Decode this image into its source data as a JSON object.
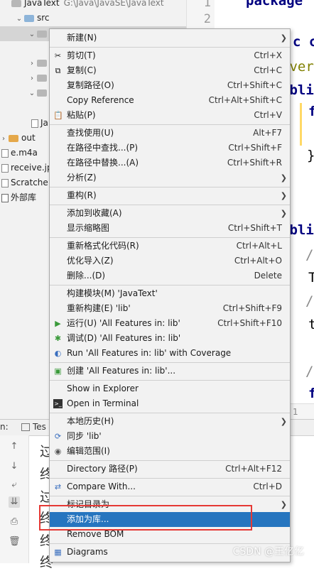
{
  "tree": {
    "project_name": "JavaText",
    "project_path": "G:\\Java\\JavaSE\\JavaText",
    "src_label": "src",
    "hidden_item_label": "Ja",
    "out_label": "out",
    "files": [
      "e.m4a",
      "receive.jp"
    ],
    "scratches_label": "Scratche",
    "external_label": "外部库"
  },
  "gutter": {
    "line_numbers": [
      "1",
      "2"
    ]
  },
  "editor": {
    "lines": [
      "package",
      "c c",
      "Over",
      "ubli",
      "f",
      "}",
      "ubli",
      "/",
      "T",
      "/",
      "t",
      "/",
      "f"
    ],
    "footer_number": "1"
  },
  "bottom": {
    "tab_prefix": "n:",
    "tab_label": "Tes",
    "output_lines": [
      "过",
      "终",
      "过",
      "终",
      "终",
      "终"
    ]
  },
  "menu": {
    "items": [
      {
        "label": "新建(N)",
        "shortcut": "",
        "submenu": true,
        "icon": ""
      },
      {
        "label": "剪切(T)",
        "shortcut": "Ctrl+X",
        "submenu": false,
        "icon": "cut-icon"
      },
      {
        "label": "复制(C)",
        "shortcut": "Ctrl+C",
        "submenu": false,
        "icon": "copy-icon"
      },
      {
        "label": "复制路径(O)",
        "shortcut": "Ctrl+Shift+C",
        "submenu": false,
        "icon": ""
      },
      {
        "label": "Copy Reference",
        "shortcut": "Ctrl+Alt+Shift+C",
        "submenu": false,
        "icon": ""
      },
      {
        "label": "粘贴(P)",
        "shortcut": "Ctrl+V",
        "submenu": false,
        "icon": "paste-icon"
      },
      {
        "label": "查找使用(U)",
        "shortcut": "Alt+F7",
        "submenu": false,
        "icon": ""
      },
      {
        "label": "在路径中查找...(P)",
        "shortcut": "Ctrl+Shift+F",
        "submenu": false,
        "icon": ""
      },
      {
        "label": "在路径中替换...(A)",
        "shortcut": "Ctrl+Shift+R",
        "submenu": false,
        "icon": ""
      },
      {
        "label": "分析(Z)",
        "shortcut": "",
        "submenu": true,
        "icon": ""
      },
      {
        "label": "重构(R)",
        "shortcut": "",
        "submenu": true,
        "icon": ""
      },
      {
        "label": "添加到收藏(A)",
        "shortcut": "",
        "submenu": true,
        "icon": ""
      },
      {
        "label": "显示缩略图",
        "shortcut": "Ctrl+Shift+T",
        "submenu": false,
        "icon": ""
      },
      {
        "label": "重新格式化代码(R)",
        "shortcut": "Ctrl+Alt+L",
        "submenu": false,
        "icon": ""
      },
      {
        "label": "优化导入(Z)",
        "shortcut": "Ctrl+Alt+O",
        "submenu": false,
        "icon": ""
      },
      {
        "label": "删除...(D)",
        "shortcut": "Delete",
        "submenu": false,
        "icon": ""
      },
      {
        "label": "构建模块(M) 'JavaText'",
        "shortcut": "",
        "submenu": false,
        "icon": ""
      },
      {
        "label": "重新构建(E) 'lib'",
        "shortcut": "Ctrl+Shift+F9",
        "submenu": false,
        "icon": ""
      },
      {
        "label": "运行(U) 'All Features in: lib'",
        "shortcut": "Ctrl+Shift+F10",
        "submenu": false,
        "icon": "run-icon"
      },
      {
        "label": "调试(D) 'All Features in: lib'",
        "shortcut": "",
        "submenu": false,
        "icon": "debug-icon"
      },
      {
        "label": "Run 'All Features in: lib' with Coverage",
        "shortcut": "",
        "submenu": false,
        "icon": "coverage-icon"
      },
      {
        "label": "创建 'All Features in: lib'...",
        "shortcut": "",
        "submenu": false,
        "icon": "create-config-icon"
      },
      {
        "label": "Show in Explorer",
        "shortcut": "",
        "submenu": false,
        "icon": ""
      },
      {
        "label": "Open in Terminal",
        "shortcut": "",
        "submenu": false,
        "icon": "terminal-icon"
      },
      {
        "label": "本地历史(H)",
        "shortcut": "",
        "submenu": true,
        "icon": ""
      },
      {
        "label": "同步 'lib'",
        "shortcut": "",
        "submenu": false,
        "icon": "sync-icon"
      },
      {
        "label": "编辑范围(I)",
        "shortcut": "",
        "submenu": false,
        "icon": "scope-icon"
      },
      {
        "label": "Directory 路径(P)",
        "shortcut": "Ctrl+Alt+F12",
        "submenu": false,
        "icon": ""
      },
      {
        "label": "Compare With...",
        "shortcut": "Ctrl+D",
        "submenu": false,
        "icon": "compare-icon"
      },
      {
        "label": "标记目录为",
        "shortcut": "",
        "submenu": true,
        "icon": ""
      },
      {
        "label": "添加为库...",
        "shortcut": "",
        "submenu": false,
        "icon": ""
      },
      {
        "label": "Remove BOM",
        "shortcut": "",
        "submenu": false,
        "icon": ""
      },
      {
        "label": "Diagrams",
        "shortcut": "",
        "submenu": true,
        "icon": "diagrams-icon"
      }
    ]
  },
  "watermark": "CSDN @王亿亿",
  "colors": {
    "highlight": "#2675bf",
    "annotation_box": "#e53935"
  }
}
